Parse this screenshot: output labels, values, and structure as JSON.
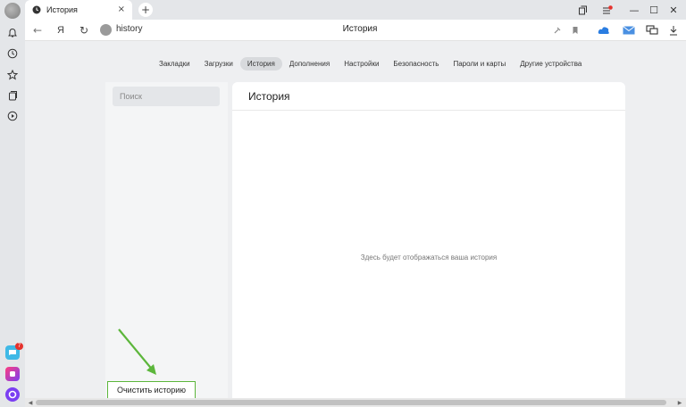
{
  "window": {
    "tab_title": "История",
    "tab_close": "×",
    "new_tab": "+",
    "controls": {
      "collections": "⧉",
      "menu": "≡",
      "minimize": "—",
      "maximize": "☐",
      "close": "✕"
    }
  },
  "address_bar": {
    "back": "←",
    "yandex": "Я",
    "reload": "↻",
    "url": "history",
    "page_title": "История"
  },
  "settings_nav": {
    "items": [
      {
        "label": "Закладки"
      },
      {
        "label": "Загрузки"
      },
      {
        "label": "История",
        "active": true
      },
      {
        "label": "Дополнения"
      },
      {
        "label": "Настройки"
      },
      {
        "label": "Безопасность"
      },
      {
        "label": "Пароли и карты"
      },
      {
        "label": "Другие устройства"
      }
    ]
  },
  "history": {
    "search_placeholder": "Поиск",
    "title": "История",
    "empty_message": "Здесь будет отображаться ваша история",
    "clear_button": "Очистить историю"
  },
  "sidebar": {
    "badge_count": "7"
  },
  "colors": {
    "accent_green": "#5cb63b",
    "notification_red": "#e5322d",
    "alice_purple": "#7b3ff2"
  },
  "icons": [
    "bell-icon",
    "clock-icon",
    "star-icon",
    "collections-icon",
    "play-icon",
    "pin-icon",
    "bookmark-icon",
    "cloud-icon",
    "mail-icon",
    "messenger-icon",
    "download-icon",
    "messenger-app-icon",
    "music-app-icon",
    "alice-icon"
  ]
}
